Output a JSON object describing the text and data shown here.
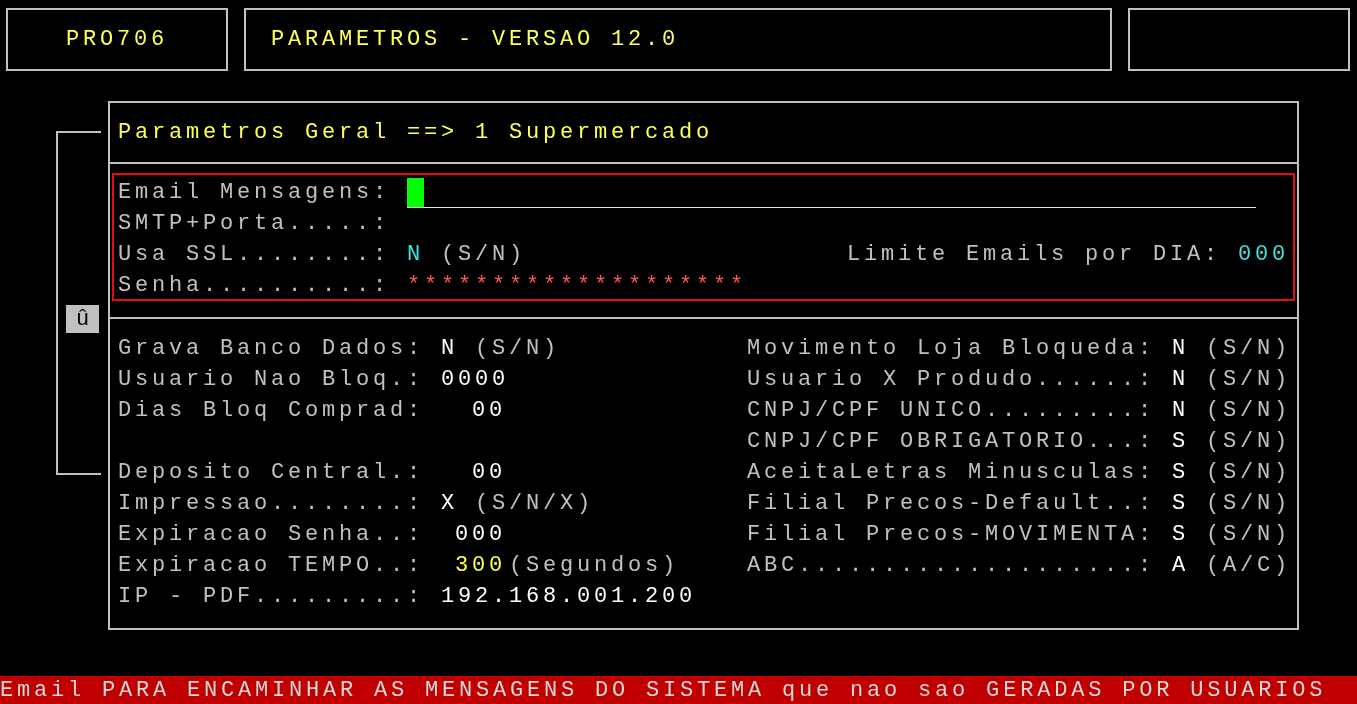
{
  "header": {
    "program_code": "PRO706",
    "title": "PARAMETROS - VERSAO 12.0"
  },
  "panel": {
    "title": "Parametros Geral ==> 1 Supermercado",
    "email_section": {
      "email": {
        "label": "Email Mensagens:",
        "focused": true
      },
      "smtp": {
        "label": "SMTP+Porta.....:"
      },
      "ssl": {
        "label": "Usa SSL........:",
        "value": "N",
        "hint": "(S/N)"
      },
      "limit": {
        "label": "Limite Emails por DIA:",
        "value": "000"
      },
      "password": {
        "label": "Senha..........:",
        "value": "********************"
      }
    },
    "rows": [
      {
        "left": {
          "label": "Grava Banco Dados:",
          "value": "N",
          "hint": "(S/N)",
          "kind": "flag",
          "highlight": false
        },
        "right": {
          "label": "Movimento Loja Bloqueda:",
          "value": "N",
          "hint": "(S/N)"
        }
      },
      {
        "left": {
          "label": "Usuario Nao Bloq.:",
          "value": "0000",
          "kind": "number",
          "highlight": false
        },
        "right": {
          "label": "Usuario X Produdo......:",
          "value": "N",
          "hint": "(S/N)"
        }
      },
      {
        "left": {
          "label": "Dias Bloq Comprad:",
          "value": "00",
          "kind": "number",
          "highlight": false
        },
        "right": {
          "label": "CNPJ/CPF UNICO.........:",
          "value": "N",
          "hint": "(S/N)"
        }
      },
      {
        "right": {
          "label": "CNPJ/CPF OBRIGATORIO...:",
          "value": "S",
          "hint": "(S/N)"
        }
      },
      {
        "left": {
          "label": "Deposito Central.:",
          "value": "00",
          "kind": "number",
          "highlight": false
        },
        "right": {
          "label": "AceitaLetras Minusculas:",
          "value": "S",
          "hint": "(S/N)"
        }
      },
      {
        "left": {
          "label": "Impressao........:",
          "value": "X",
          "hint": "(S/N/X)",
          "kind": "flag",
          "highlight": false
        },
        "right": {
          "label": "Filial Precos-Default..:",
          "value": "S",
          "hint": "(S/N)"
        }
      },
      {
        "left": {
          "label": "Expiracao Senha..:",
          "value": "000",
          "kind": "number",
          "highlight": false
        },
        "right": {
          "label": "Filial Precos-MOVIMENTA:",
          "value": "S",
          "hint": "(S/N)"
        }
      },
      {
        "left": {
          "label": "Expiracao TEMPO..:",
          "value": "300",
          "hint": "(Segundos)",
          "kind": "number",
          "highlight": true
        },
        "right": {
          "label": "ABC....................:",
          "value": "A",
          "hint": "(A/C)"
        }
      },
      {
        "left": {
          "label": "IP - PDF.........:",
          "value": "192.168.001.200",
          "kind": "text",
          "highlight": false
        }
      }
    ]
  },
  "side_marker": "û",
  "status_bar": "Email PARA ENCAMINHAR AS MENSAGENS DO SISTEMA que nao sao GERADAS POR USUARIOS"
}
